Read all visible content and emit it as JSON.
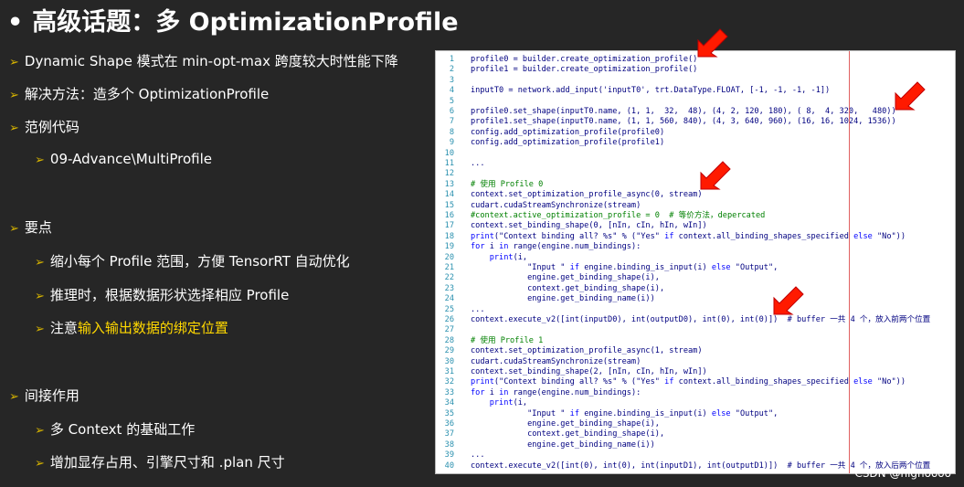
{
  "title": {
    "bullet": "•",
    "text": "高级话题：多 OptimizationProfile"
  },
  "bullets": [
    {
      "text": "Dynamic Shape 模式在 min-opt-max 跨度较大时性能下降",
      "level": 0
    },
    {
      "text": "解决方法：造多个 OptimizationProfile",
      "level": 0
    },
    {
      "text": "范例代码",
      "level": 0
    },
    {
      "text": "09-Advance\\MultiProfile",
      "level": 1
    },
    {
      "text": "要点",
      "level": 0
    },
    {
      "text": "缩小每个 Profile 范围，方便 TensorRT 自动优化",
      "level": 1
    },
    {
      "text": "推理时，根据数据形状选择相应 Profile",
      "level": 1
    },
    {
      "text_pre": "注意",
      "text_hl": "输入输出数据的绑定位置",
      "level": 1
    },
    {
      "text": "间接作用",
      "level": 0
    },
    {
      "text": "多 Context 的基础工作",
      "level": 1
    },
    {
      "text": "增加显存占用、引擎尺寸和 .plan 尺寸",
      "level": 1
    }
  ],
  "code_lines": [
    {
      "n": "1",
      "t": "profile0 = builder.create_optimization_profile()"
    },
    {
      "n": "2",
      "t": "profile1 = builder.create_optimization_profile()"
    },
    {
      "n": "3",
      "t": ""
    },
    {
      "n": "4",
      "t": "inputT0 = network.add_input('inputT0', trt.DataType.FLOAT, [-1, -1, -1, -1])"
    },
    {
      "n": "5",
      "t": ""
    },
    {
      "n": "6",
      "t": "profile0.set_shape(inputT0.name, (1, 1,  32,  48), (4, 2, 120, 180), ( 8,  4, 320,   480))"
    },
    {
      "n": "7",
      "t": "profile1.set_shape(inputT0.name, (1, 1, 560, 840), (4, 3, 640, 960), (16, 16, 1024, 1536))"
    },
    {
      "n": "8",
      "t": "config.add_optimization_profile(profile0)"
    },
    {
      "n": "9",
      "t": "config.add_optimization_profile(profile1)"
    },
    {
      "n": "10",
      "t": ""
    },
    {
      "n": "11",
      "t": "..."
    },
    {
      "n": "12",
      "t": ""
    },
    {
      "n": "13",
      "t": "# 使用 Profile 0"
    },
    {
      "n": "14",
      "t": "context.set_optimization_profile_async(0, stream)"
    },
    {
      "n": "15",
      "t": "cudart.cudaStreamSynchronize(stream)"
    },
    {
      "n": "16",
      "t": "#context.active_optimization_profile = 0  # 等价方法，depercated"
    },
    {
      "n": "17",
      "t": "context.set_binding_shape(0, [nIn, cIn, hIn, wIn])"
    },
    {
      "n": "18",
      "t": "print(\"Context binding all? %s\" % (\"Yes\" if context.all_binding_shapes_specified else \"No\"))"
    },
    {
      "n": "19",
      "t": "for i in range(engine.num_bindings):"
    },
    {
      "n": "20",
      "t": "    print(i,"
    },
    {
      "n": "21",
      "t": "            \"Input \" if engine.binding_is_input(i) else \"Output\","
    },
    {
      "n": "22",
      "t": "            engine.get_binding_shape(i),"
    },
    {
      "n": "23",
      "t": "            context.get_binding_shape(i),"
    },
    {
      "n": "24",
      "t": "            engine.get_binding_name(i))"
    },
    {
      "n": "25",
      "t": "..."
    },
    {
      "n": "26",
      "t": "context.execute_v2([int(inputD0), int(outputD0), int(0), int(0)])  # buffer 一共 4 个，放入前两个位置"
    },
    {
      "n": "27",
      "t": ""
    },
    {
      "n": "28",
      "t": "# 使用 Profile 1"
    },
    {
      "n": "29",
      "t": "context.set_optimization_profile_async(1, stream)"
    },
    {
      "n": "30",
      "t": "cudart.cudaStreamSynchronize(stream)"
    },
    {
      "n": "31",
      "t": "context.set_binding_shape(2, [nIn, cIn, hIn, wIn])"
    },
    {
      "n": "32",
      "t": "print(\"Context binding all? %s\" % (\"Yes\" if context.all_binding_shapes_specified else \"No\"))"
    },
    {
      "n": "33",
      "t": "for i in range(engine.num_bindings):"
    },
    {
      "n": "34",
      "t": "    print(i,"
    },
    {
      "n": "35",
      "t": "            \"Input \" if engine.binding_is_input(i) else \"Output\","
    },
    {
      "n": "36",
      "t": "            engine.get_binding_shape(i),"
    },
    {
      "n": "37",
      "t": "            context.get_binding_shape(i),"
    },
    {
      "n": "38",
      "t": "            engine.get_binding_name(i))"
    },
    {
      "n": "39",
      "t": "..."
    },
    {
      "n": "40",
      "t": "context.execute_v2([int(0), int(0), int(inputD1), int(outputD1)])  # buffer 一共 4 个，放入后两个位置"
    }
  ],
  "watermark": "CSDN @highoooo",
  "colors": {
    "background": "#262626",
    "accent": "#ffd800",
    "marker": "#ff1a00"
  }
}
